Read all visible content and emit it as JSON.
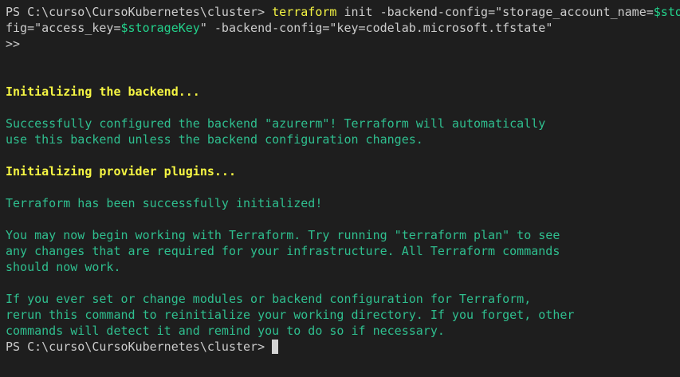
{
  "lines": {
    "l1_prompt": "PS C:\\curso\\CursoKubernetes\\cluster> ",
    "l1_cmd": "terraform",
    "l1_args": " init -backend-config=\"storage_account_name=",
    "l1_var": "$sto",
    "l2_a": "fig=\"access_key=",
    "l2_var": "$storageKey",
    "l2_b": "\" -backend-config=\"key=codelab.microsoft.tfstate\"",
    "l3": ">>",
    "l6": "Initializing the backend...",
    "l8": "Successfully configured the backend \"azurerm\"! Terraform will automatically",
    "l9": "use this backend unless the backend configuration changes.",
    "l11": "Initializing provider plugins...",
    "l13": "Terraform has been successfully initialized!",
    "l15": "You may now begin working with Terraform. Try running \"terraform plan\" to see",
    "l16": "any changes that are required for your infrastructure. All Terraform commands",
    "l17": "should now work.",
    "l19": "If you ever set or change modules or backend configuration for Terraform,",
    "l20": "rerun this command to reinitialize your working directory. If you forget, other",
    "l21": "commands will detect it and remind you to do so if necessary.",
    "l22_prompt": "PS C:\\curso\\CursoKubernetes\\cluster> "
  },
  "colors": {
    "background": "#1e1e1e",
    "text": "#cccccc",
    "yellow": "#f5f543",
    "green": "#2fbf8f",
    "variable": "#23d18b"
  }
}
